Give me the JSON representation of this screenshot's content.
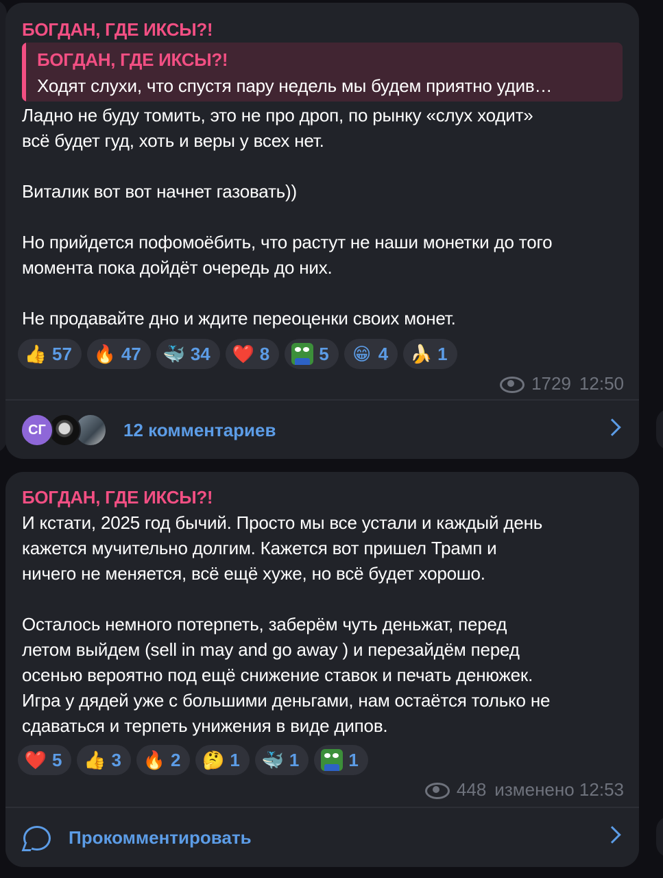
{
  "posts": [
    {
      "author": "БОГДАН, ГДЕ ИКСЫ?!",
      "quote": {
        "author": "БОГДАН, ГДЕ ИКСЫ?!",
        "text": "Ходят слухи, что спустя пару недель мы будем приятно удив…"
      },
      "lines": [
        "Ладно не буду томить, это не про дроп, по рынку «слух ходит»",
        "всё будет гуд, хоть и веры у всех нет.",
        "",
        "Виталик вот вот начнет газовать))",
        "",
        "Но прийдется пофомоёбить, что растут не наши монетки до того",
        "момента пока дойдёт очередь до них.",
        "",
        "Не продавайте дно и ждите переоценки своих монет."
      ],
      "reactions": [
        {
          "icon": "thumbs-up-icon",
          "emoji": "👍",
          "count": "57"
        },
        {
          "icon": "fire-icon",
          "emoji": "🔥",
          "count": "47"
        },
        {
          "icon": "whale-icon",
          "emoji": "🐳",
          "count": "34"
        },
        {
          "icon": "heart-icon",
          "emoji": "❤️",
          "count": "8"
        },
        {
          "icon": "pepe-icon",
          "emoji": "",
          "count": "5"
        },
        {
          "icon": "grin-icon",
          "emoji": "😁",
          "count": "4"
        },
        {
          "icon": "banana-icon",
          "emoji": "🍌",
          "count": "1"
        }
      ],
      "views": "1729",
      "time": "12:50",
      "comments_label": "12 комментариев",
      "avatar_initials": "СГ"
    },
    {
      "author": "БОГДАН, ГДЕ ИКСЫ?!",
      "lines": [
        "И кстати, 2025 год бычий. Просто мы все устали и каждый день",
        "кажется мучительно долгим. Кажется вот пришел Трамп и",
        "ничего не меняется, всё ещё хуже, но всё будет хорошо.",
        "",
        "Осталось немного потерпеть, заберём чуть деньжат, перед",
        "летом выйдем (sell in may and go away ) и перезайдём перед",
        "осенью вероятно под ещё снижение ставок и печать денюжек.",
        "Игра у дядей уже с большими деньгами, нам остаётся только не",
        "сдаваться и терпеть унижения в виде дипов."
      ],
      "reactions": [
        {
          "icon": "heart-icon",
          "emoji": "❤️",
          "count": "5"
        },
        {
          "icon": "thumbs-up-icon",
          "emoji": "👍",
          "count": "3"
        },
        {
          "icon": "fire-icon",
          "emoji": "🔥",
          "count": "2"
        },
        {
          "icon": "thinking-icon",
          "emoji": "🤔",
          "count": "1"
        },
        {
          "icon": "whale-icon",
          "emoji": "🐳",
          "count": "1"
        },
        {
          "icon": "pepe-icon",
          "emoji": "",
          "count": "1"
        }
      ],
      "views": "448",
      "time": "изменено 12:53",
      "comments_label": "Прокомментировать"
    }
  ]
}
